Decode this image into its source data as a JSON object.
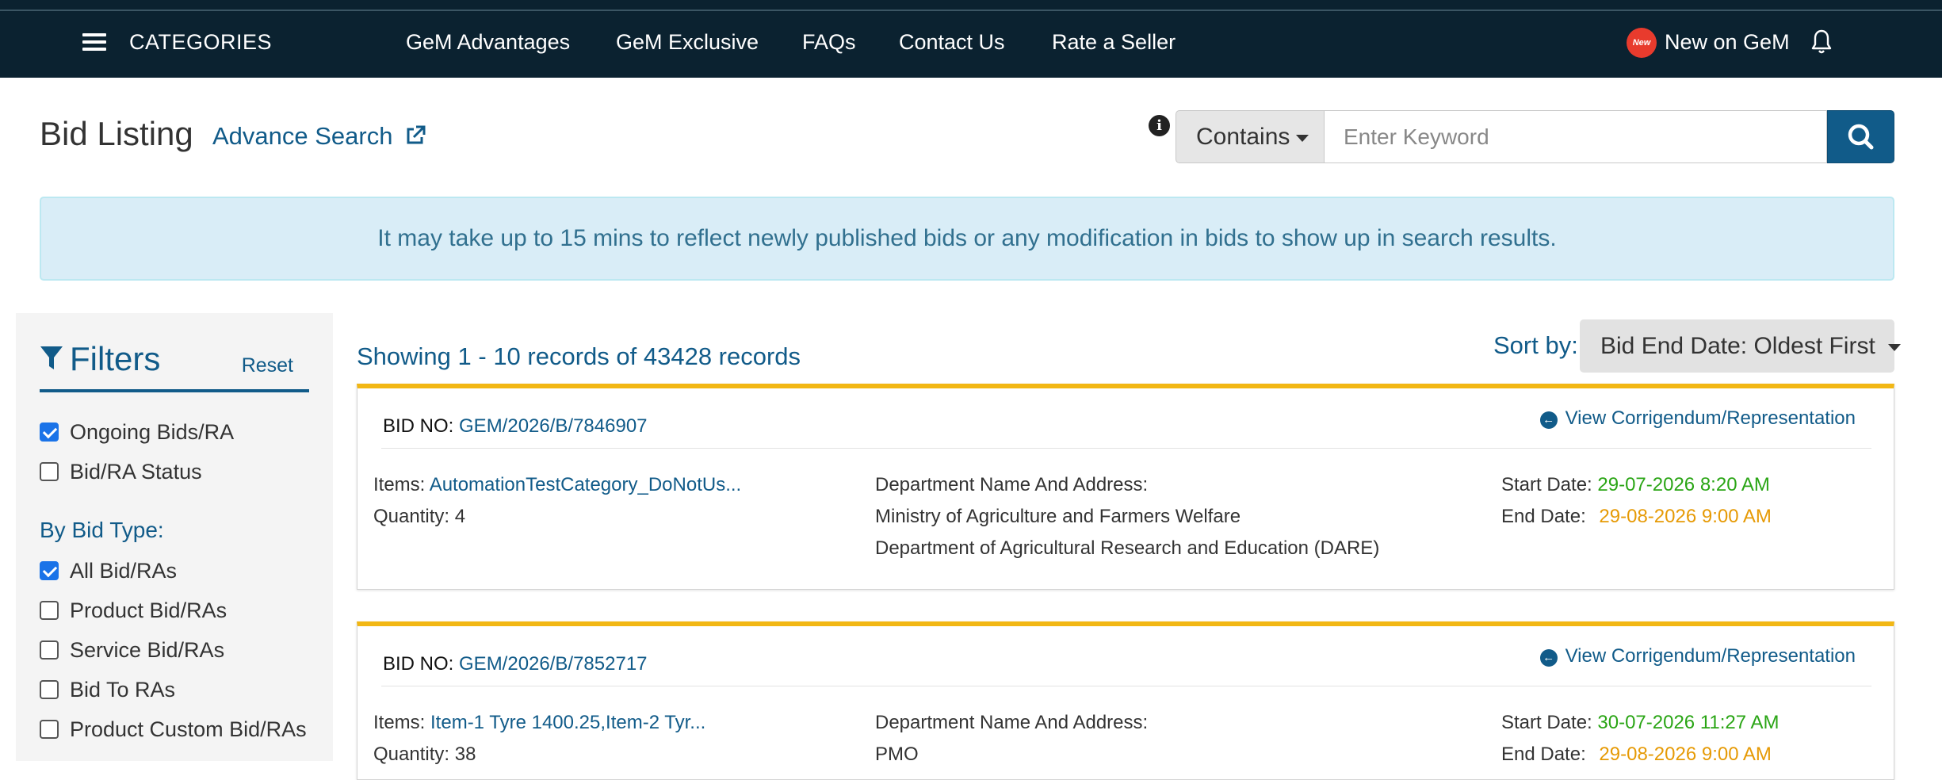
{
  "nav": {
    "categories": "CATEGORIES",
    "links": [
      "GeM Advantages",
      "GeM Exclusive",
      "FAQs",
      "Contact Us",
      "Rate a Seller"
    ],
    "new_badge": "New",
    "new_on_gem": "New on GeM"
  },
  "header": {
    "title": "Bid Listing",
    "advance_search": "Advance Search",
    "contains": "Contains",
    "search_placeholder": "Enter Keyword"
  },
  "alert": "It may take up to 15 mins to reflect newly published bids or any modification in bids to show up in search results.",
  "filters": {
    "title": "Filters",
    "reset": "Reset",
    "status_items": [
      {
        "label": "Ongoing Bids/RA",
        "checked": true
      },
      {
        "label": "Bid/RA Status",
        "checked": false
      }
    ],
    "by_bid_type": "By Bid Type:",
    "type_items": [
      {
        "label": "All Bid/RAs",
        "checked": true
      },
      {
        "label": "Product Bid/RAs",
        "checked": false
      },
      {
        "label": "Service Bid/RAs",
        "checked": false
      },
      {
        "label": "Bid To RAs",
        "checked": false
      },
      {
        "label": "Product Custom Bid/RAs",
        "checked": false
      }
    ]
  },
  "listing": {
    "records_text": "Showing 1 - 10 records of 43428 records",
    "sort_label": "Sort by:",
    "sort_value": "Bid End Date: Oldest First"
  },
  "labels": {
    "bid_no": "BID NO:",
    "view_corr": "View Corrigendum/Representation",
    "items": "Items:",
    "quantity": "Quantity:",
    "dept": "Department Name And Address:",
    "start": "Start Date:",
    "end": "End Date:"
  },
  "bids": [
    {
      "bid_no": "GEM/2026/B/7846907",
      "items": "AutomationTestCategory_DoNotUs...",
      "quantity": "4",
      "dept_line1": "Ministry of Agriculture and Farmers Welfare",
      "dept_line2": "Department of Agricultural Research and Education (DARE)",
      "start_date": "29-07-2026 8:20 AM",
      "end_date": "29-08-2026 9:00 AM"
    },
    {
      "bid_no": "GEM/2026/B/7852717",
      "items": "Item-1 Tyre 1400.25,Item-2 Tyr...",
      "quantity": "38",
      "dept_line1": "PMO",
      "dept_line2": "",
      "start_date": "30-07-2026 11:27 AM",
      "end_date": "29-08-2026 9:00 AM"
    }
  ],
  "colors": {
    "nav_bg": "#0b2230",
    "brand_blue": "#115b89",
    "accent_gold": "#f2b714",
    "start_green": "#2aa515",
    "end_orange": "#e69a05"
  }
}
